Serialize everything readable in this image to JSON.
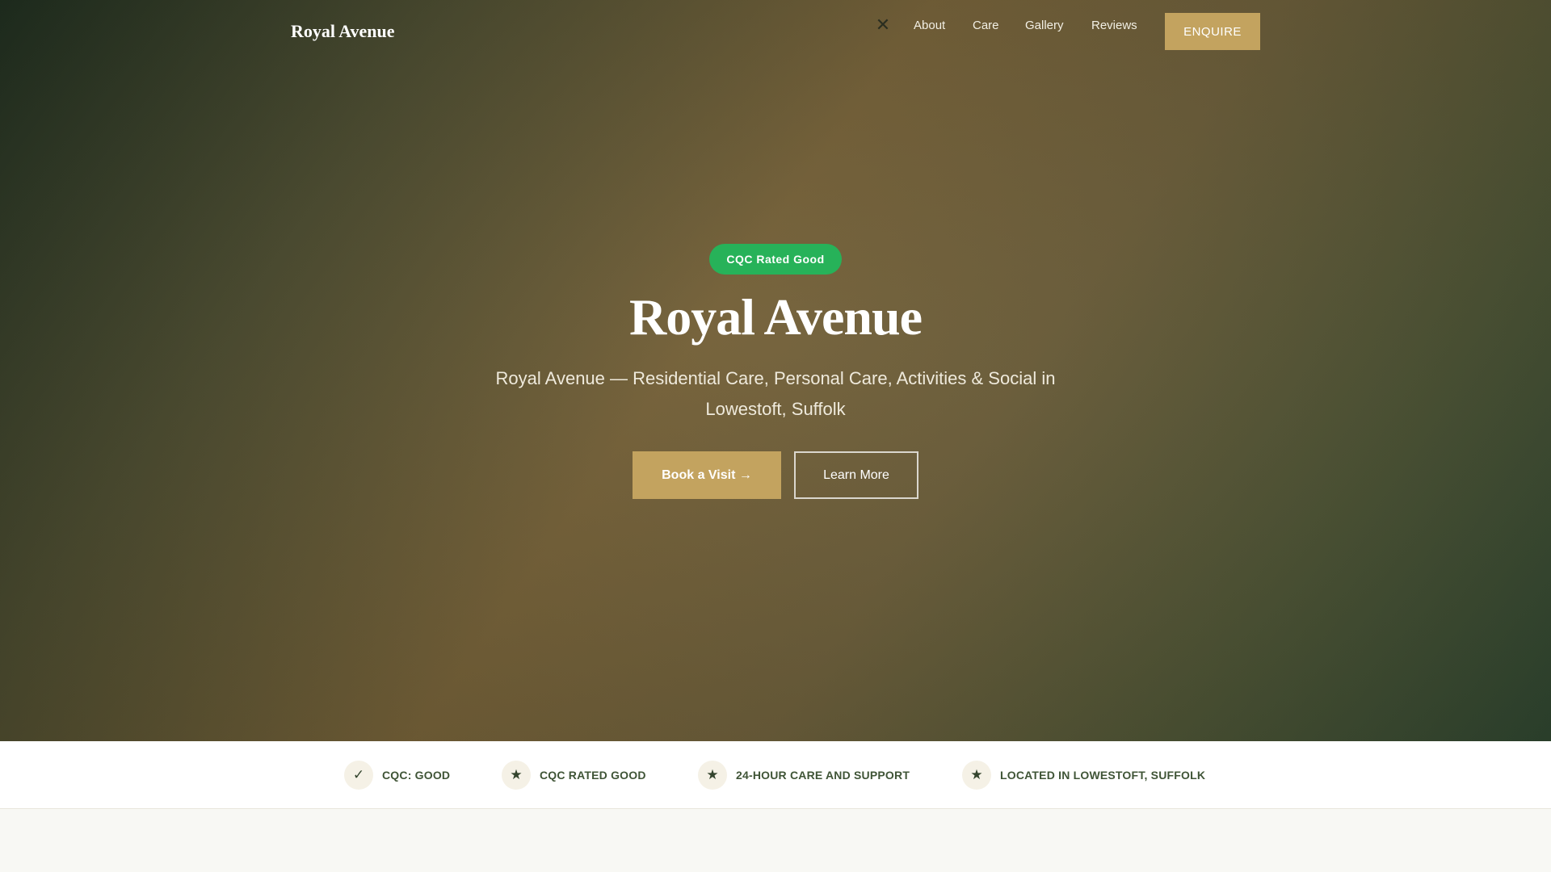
{
  "header": {
    "brand": "Royal Avenue",
    "close_icon": "close-icon",
    "nav_items": [
      {
        "label": "About"
      },
      {
        "label": "Care"
      },
      {
        "label": "Gallery"
      },
      {
        "label": "Reviews"
      }
    ],
    "cta_label": "ENQUIRE"
  },
  "hero": {
    "badge": "CQC Rated Good",
    "title": "Royal Avenue",
    "subtitle": "Royal Avenue — Residential Care, Personal Care, Activities & Social in Lowestoft, Suffolk",
    "primary_button": "Book a Visit →",
    "secondary_button": "Learn More"
  },
  "trust_bar": {
    "items": [
      {
        "icon": "check-icon",
        "glyph": "✓",
        "label": "CQC: GOOD"
      },
      {
        "icon": "star-icon",
        "glyph": "★",
        "label": "CQC RATED GOOD"
      },
      {
        "icon": "star-icon",
        "glyph": "★",
        "label": "24-HOUR CARE AND SUPPORT"
      },
      {
        "icon": "star-icon",
        "glyph": "★",
        "label": "LOCATED IN LOWESTOFT, SUFFOLK"
      }
    ]
  },
  "colors": {
    "accent_gold": "#c3a35f",
    "badge_green": "#27b259",
    "text_dark_green": "#3f5436"
  }
}
